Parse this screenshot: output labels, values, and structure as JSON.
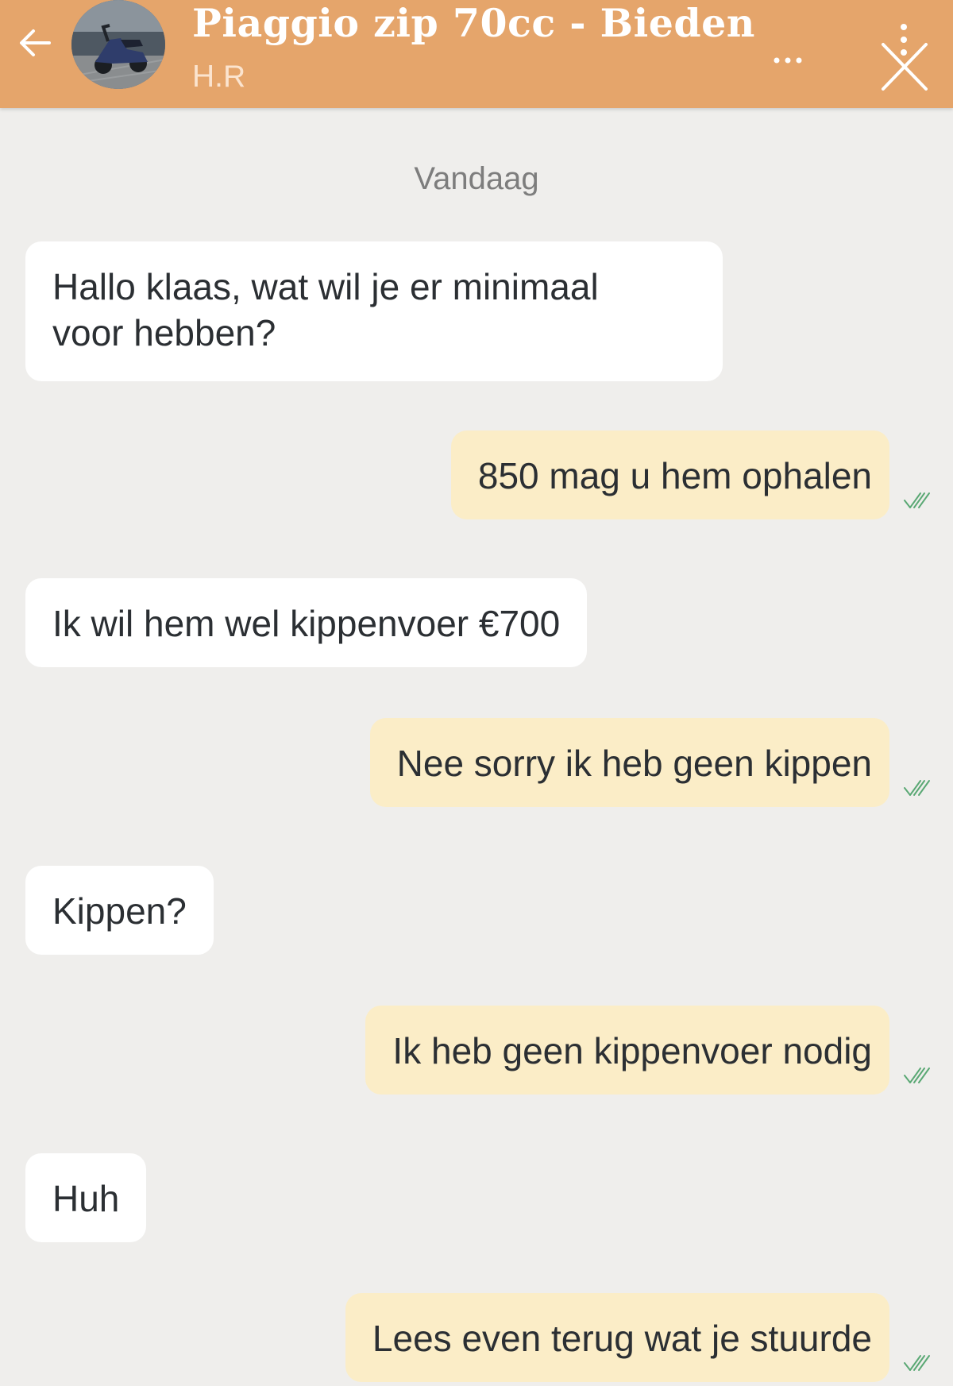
{
  "header": {
    "title": "Piaggio zip 70cc - Bieden",
    "subtitle": "H.R",
    "back_icon": "arrow-left-icon",
    "menu_icon": "more-horizontal-icon",
    "close_icon": "close-icon",
    "background_color": "#e5a56b"
  },
  "date_separator": "Vandaag",
  "messages": [
    {
      "direction": "incoming",
      "lines": [
        "Hallo klaas, wat wil je er minimaal",
        "voor hebben?"
      ]
    },
    {
      "direction": "outgoing",
      "text": "850 mag u hem ophalen",
      "status_icon": "double-check-icon"
    },
    {
      "direction": "incoming",
      "text": "Ik wil hem wel kippenvoer €700"
    },
    {
      "direction": "outgoing",
      "text": "Nee sorry ik heb geen kippen",
      "status_icon": "double-check-icon"
    },
    {
      "direction": "incoming",
      "text": "Kippen?"
    },
    {
      "direction": "outgoing",
      "text": "Ik heb geen kippenvoer nodig",
      "status_icon": "double-check-icon"
    },
    {
      "direction": "incoming",
      "text": "Huh"
    },
    {
      "direction": "outgoing",
      "text": "Lees even terug wat je stuurde",
      "status_icon": "double-check-icon"
    }
  ],
  "colors": {
    "incoming_bubble": "#ffffff",
    "outgoing_bubble": "#fbedc7",
    "chat_background": "#efeeec",
    "read_tick": "#5aa874"
  }
}
